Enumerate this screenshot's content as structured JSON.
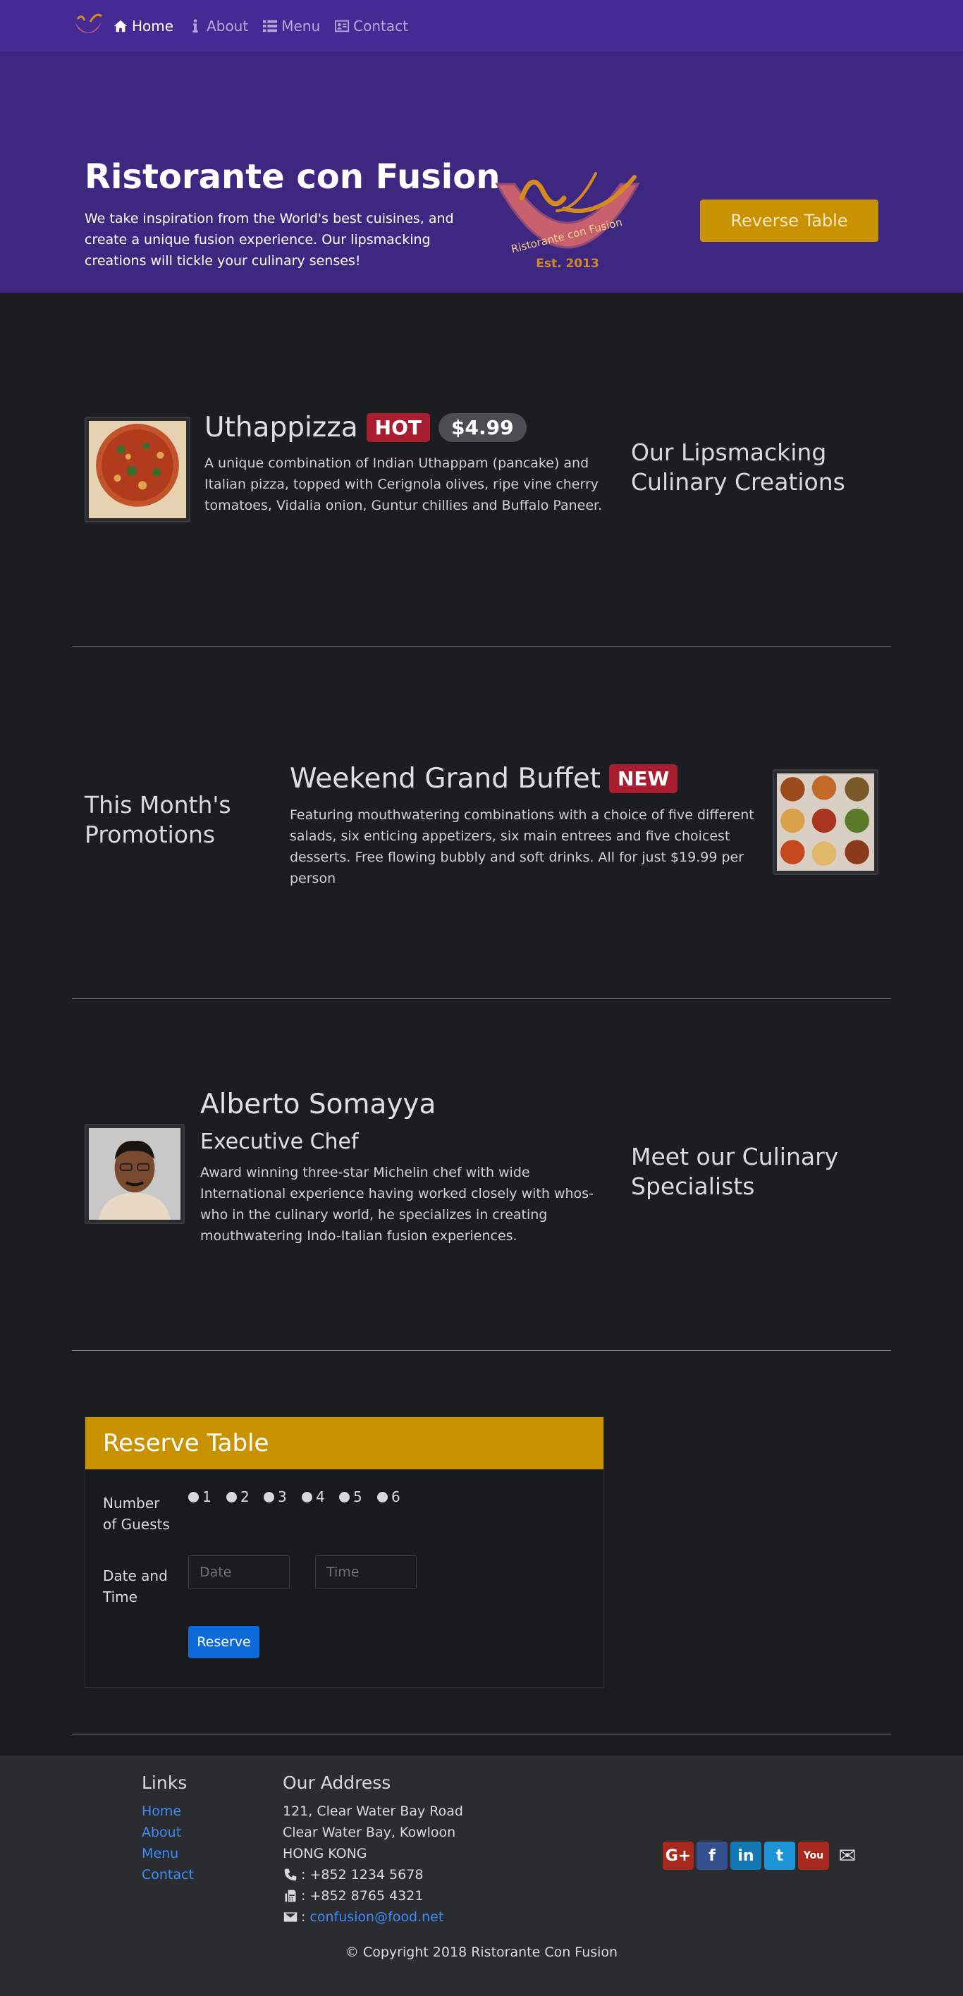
{
  "nav": {
    "items": [
      {
        "label": "Home",
        "icon": "home-icon"
      },
      {
        "label": "About",
        "icon": "info-icon"
      },
      {
        "label": "Menu",
        "icon": "list-icon"
      },
      {
        "label": "Contact",
        "icon": "address-card-icon"
      }
    ]
  },
  "jumbotron": {
    "title": "Ristorante con Fusion",
    "text": "We take inspiration from the World's best cuisines, and create a unique fusion experience. Our lipsmacking creations will tickle your culinary senses!",
    "logo_text": "Ristorante con Fusion",
    "logo_est": "Est. 2013",
    "button": "Reverse Table"
  },
  "dish": {
    "name": "Uthappizza",
    "badge": "HOT",
    "price": "$4.99",
    "description": "A unique combination of Indian Uthappam (pancake) and Italian pizza, topped with Cerignola olives, ripe vine cherry tomatoes, Vidalia onion, Guntur chillies and Buffalo Paneer.",
    "side_heading": "Our Lipsmacking Culinary Creations"
  },
  "promotion": {
    "side_heading": "This Month's Promotions",
    "name": "Weekend Grand Buffet",
    "badge": "NEW",
    "description": "Featuring mouthwatering combinations with a choice of five different salads, six enticing appetizers, six main entrees and five choicest desserts. Free flowing bubbly and soft drinks. All for just $19.99 per person"
  },
  "leader": {
    "name": "Alberto Somayya",
    "designation": "Executive Chef",
    "description": "Award winning three-star Michelin chef with wide International experience having worked closely with whos-who in the culinary world, he specializes in creating mouthwatering Indo-Italian fusion experiences.",
    "side_heading": "Meet our Culinary Specialists"
  },
  "reserve": {
    "title": "Reserve Table",
    "guests_label": "Number of Guests",
    "guest_options": [
      "1",
      "2",
      "3",
      "4",
      "5",
      "6"
    ],
    "datetime_label": "Date and Time",
    "date_placeholder": "Date",
    "time_placeholder": "Time",
    "submit": "Reserve"
  },
  "footer": {
    "links_title": "Links",
    "links": [
      "Home",
      "About",
      "Menu",
      "Contact"
    ],
    "address_title": "Our Address",
    "address": [
      "121, Clear Water Bay Road",
      "Clear Water Bay, Kowloon",
      "HONG KONG"
    ],
    "phone": ": +852 1234 5678",
    "fax": ": +852 8765 4321",
    "email_prefix": ":",
    "email": "confusion@food.net",
    "social": [
      {
        "name": "google-plus-icon",
        "label": "G+",
        "color": "#a8291e"
      },
      {
        "name": "facebook-icon",
        "label": "f",
        "color": "#35508f"
      },
      {
        "name": "linkedin-icon",
        "label": "in",
        "color": "#1478b5"
      },
      {
        "name": "twitter-icon",
        "label": "t",
        "color": "#1d94d8"
      },
      {
        "name": "youtube-icon",
        "label": "You",
        "color": "#a8291e"
      },
      {
        "name": "mail-icon",
        "label": "✉",
        "color": "transparent"
      }
    ],
    "copyright": "© Copyright 2018 Ristorante Con Fusion"
  },
  "colors": {
    "navbar": "#452a96",
    "jumbotron": "#3d2780",
    "accent": "#c99200",
    "badge_red": "#a81e30",
    "link": "#3d8bfd",
    "primary_button": "#0d6adb"
  }
}
